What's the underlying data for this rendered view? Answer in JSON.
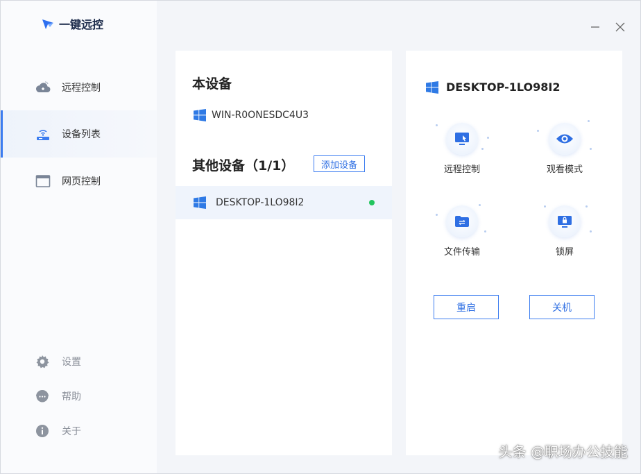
{
  "app": {
    "title": "一键远控"
  },
  "sidebar": {
    "items": [
      {
        "label": "远程控制",
        "icon": "cloud-remote-icon"
      },
      {
        "label": "设备列表",
        "icon": "router-device-icon",
        "active": true
      },
      {
        "label": "网页控制",
        "icon": "browser-window-icon"
      }
    ],
    "bottom": [
      {
        "label": "设置",
        "icon": "gear-icon"
      },
      {
        "label": "帮助",
        "icon": "chat-help-icon"
      },
      {
        "label": "关于",
        "icon": "info-icon"
      }
    ]
  },
  "window_controls": {
    "minimize": "minimize-icon",
    "close": "close-icon"
  },
  "devices": {
    "local_title": "本设备",
    "local_device": "WIN-R0ONESDC4U3",
    "other_title": "其他设备（1/1）",
    "add_button": "添加设备",
    "other_devices": [
      {
        "name": "DESKTOP-1LO98I2",
        "online": true
      }
    ]
  },
  "detail": {
    "device_name": "DESKTOP-1LO98I2",
    "actions": [
      {
        "label": "远程控制",
        "icon": "monitor-cursor-icon"
      },
      {
        "label": "观看模式",
        "icon": "eye-icon"
      },
      {
        "label": "文件传输",
        "icon": "folder-transfer-icon"
      },
      {
        "label": "锁屏",
        "icon": "lock-screen-icon"
      }
    ],
    "restart_button": "重启",
    "shutdown_button": "关机"
  },
  "colors": {
    "accent": "#3b7cf0",
    "online": "#22c55e"
  },
  "watermark": "头条 @职场办公技能"
}
